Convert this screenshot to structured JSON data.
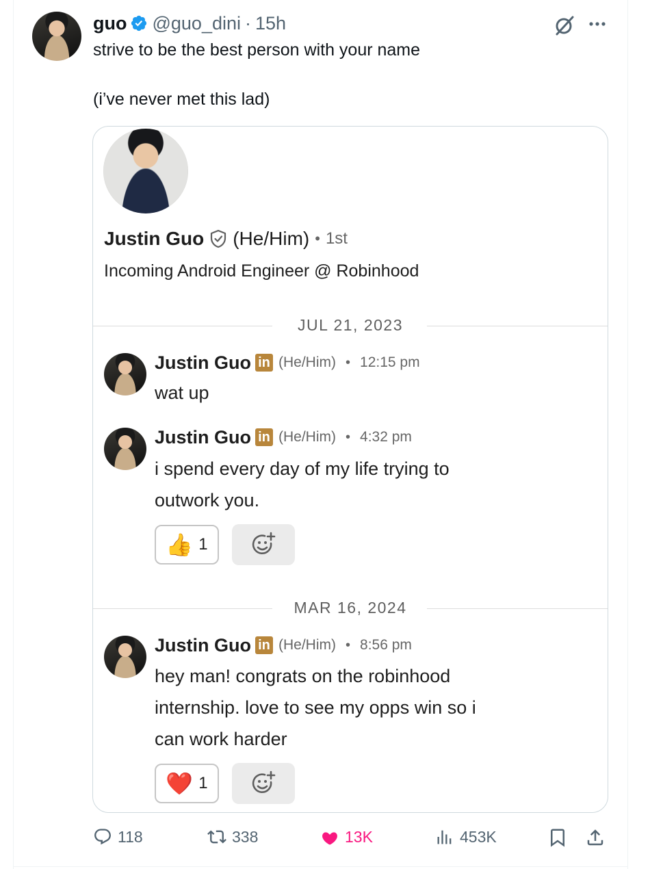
{
  "tweet": {
    "author": {
      "display_name": "guo",
      "handle": "@guo_dini",
      "verified": true
    },
    "dot": "·",
    "time": "15h",
    "text_lines": [
      "strive to be the best person with your name",
      "(i’ve never met this lad)"
    ],
    "icons": {
      "grok": "grok-icon",
      "more": "more-icon"
    }
  },
  "card": {
    "profile": {
      "name": "Justin Guo",
      "pronouns": "(He/Him)",
      "dot": "•",
      "degree": "1st",
      "headline": "Incoming Android Engineer @ Robinhood"
    },
    "date_separators": [
      "JUL 21, 2023",
      "MAR 16, 2024"
    ],
    "messages": [
      {
        "name": "Justin Guo",
        "badge": "in",
        "pronouns": "(He/Him)",
        "dot": "•",
        "time": "12:15 pm",
        "lines": [
          "wat up"
        ]
      },
      {
        "name": "Justin Guo",
        "badge": "in",
        "pronouns": "(He/Him)",
        "dot": "•",
        "time": "4:32 pm",
        "lines": [
          "i spend every day of my life trying to",
          "outwork you."
        ],
        "reaction": {
          "emoji": "👍",
          "count": "1"
        }
      },
      {
        "name": "Justin Guo",
        "badge": "in",
        "pronouns": "(He/Him)",
        "dot": "•",
        "time": "8:56 pm",
        "lines": [
          "hey man! congrats on the robinhood",
          "internship. love to see my opps win so i",
          "can work harder"
        ],
        "reaction": {
          "emoji": "❤️",
          "count": "1"
        }
      }
    ]
  },
  "actions": {
    "replies": "118",
    "reposts": "338",
    "likes": "13K",
    "views": "453K"
  },
  "colors": {
    "verified": "#1d9bf0",
    "like": "#f91880",
    "secondary_text": "#536471",
    "linkedin_badge": "#b8863b"
  }
}
